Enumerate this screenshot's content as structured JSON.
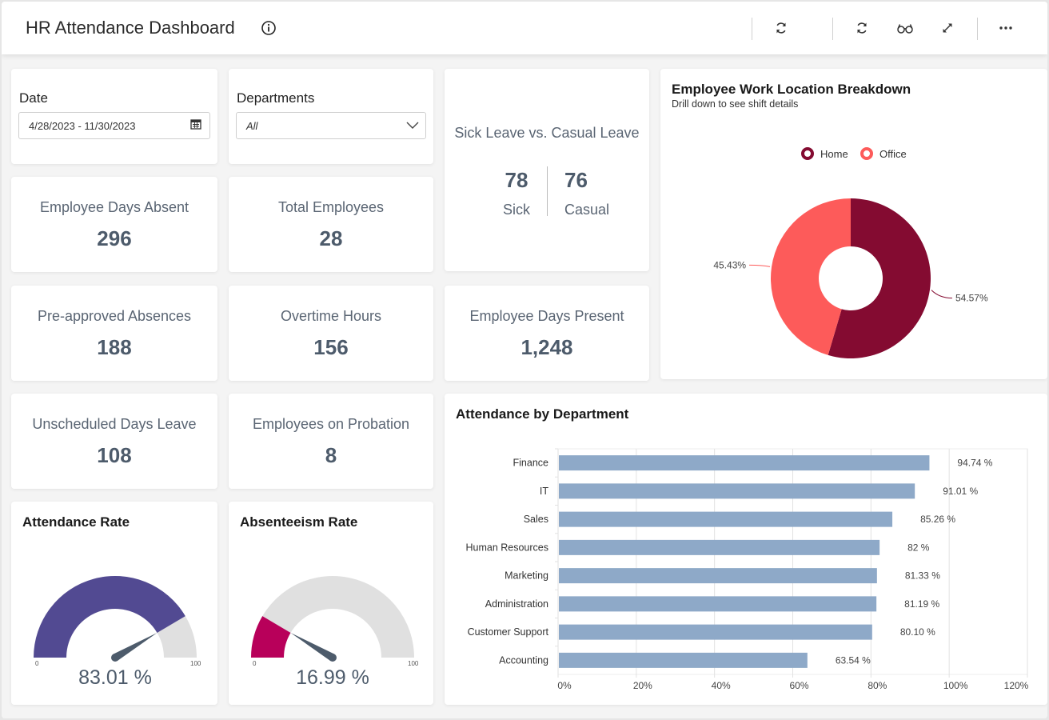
{
  "header": {
    "title": "HR Attendance Dashboard",
    "icons": [
      "info-icon",
      "refresh-icon",
      "refresh-icon",
      "glasses-icon",
      "expand-icon",
      "more-icon"
    ]
  },
  "filters": {
    "date": {
      "label": "Date",
      "value": "4/28/2023 - 11/30/2023"
    },
    "departments": {
      "label": "Departments",
      "value": "All"
    }
  },
  "kpis": [
    {
      "label": "Employee Days Absent",
      "value": "296"
    },
    {
      "label": "Total Employees",
      "value": "28"
    },
    {
      "label": "Pre-approved Absences",
      "value": "188"
    },
    {
      "label": "Overtime Hours",
      "value": "156"
    },
    {
      "label": "Employee Days Present",
      "value": "1,248"
    },
    {
      "label": "Unscheduled Days Leave",
      "value": "108"
    },
    {
      "label": "Employees on Probation",
      "value": "8"
    }
  ],
  "leave": {
    "title": "Sick Leave vs. Casual Leave",
    "sick_value": "78",
    "sick_label": "Sick",
    "casual_value": "76",
    "casual_label": "Casual"
  },
  "gauges": [
    {
      "title": "Attendance Rate",
      "value": 83.01,
      "display": "83.01 %",
      "min": "0",
      "max": "100",
      "color": "#524a92"
    },
    {
      "title": "Absenteeism Rate",
      "value": 16.99,
      "display": "16.99 %",
      "min": "0",
      "max": "100",
      "color": "#b8005a"
    }
  ],
  "chart_data": [
    {
      "type": "pie",
      "title": "Employee Work Location Breakdown",
      "subtitle": "Drill down to see shift details",
      "donut": true,
      "legend": "top-center",
      "categories": [
        "Home",
        "Office"
      ],
      "values": [
        54.57,
        45.43
      ],
      "labels": [
        "54.57%",
        "45.43%"
      ],
      "colors": [
        "#840b31",
        "#fd5b5a"
      ]
    },
    {
      "type": "bar",
      "orientation": "horizontal",
      "title": "Attendance by Department",
      "categories": [
        "Finance",
        "IT",
        "Sales",
        "Human Resources",
        "Marketing",
        "Administration",
        "Customer Support",
        "Accounting"
      ],
      "values": [
        94.74,
        91.01,
        85.26,
        82,
        81.33,
        81.19,
        80.1,
        63.54
      ],
      "data_labels": [
        "94.74 %",
        "91.01 %",
        "85.26 %",
        "82 %",
        "81.33 %",
        "81.19 %",
        "80.10 %",
        "63.54 %"
      ],
      "xlim": [
        0,
        120
      ],
      "xticks": [
        "0%",
        "20%",
        "40%",
        "60%",
        "80%",
        "100%",
        "120%"
      ],
      "xtick_values": [
        0,
        20,
        40,
        60,
        80,
        100,
        120
      ],
      "grid": true,
      "bar_color": "#8ea9c8"
    }
  ]
}
